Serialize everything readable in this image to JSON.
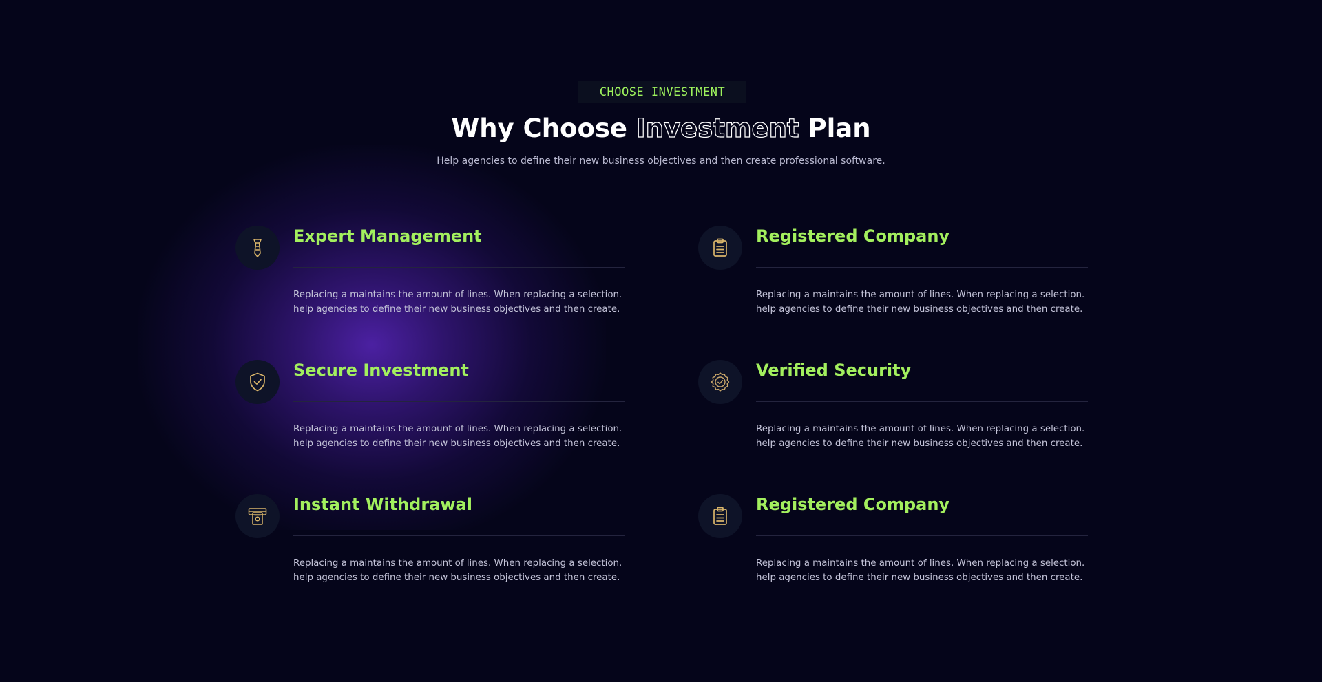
{
  "header": {
    "tag": "CHOOSE INVESTMENT",
    "title_part1": "Why Choose ",
    "title_highlight": "Investment",
    "title_part2": " Plan",
    "subtitle": "Help agencies to define their new business objectives and then create professional software."
  },
  "features": [
    {
      "title": "Expert Management",
      "icon": "tie-icon",
      "desc_line1": "Replacing a maintains the amount of lines. When replacing a selection.",
      "desc_line2": "help agencies to define their new business objectives and then create."
    },
    {
      "title": "Registered Company",
      "icon": "clipboard-icon",
      "desc_line1": "Replacing a maintains the amount of lines. When replacing a selection.",
      "desc_line2": "help agencies to define their new business objectives and then create."
    },
    {
      "title": "Secure Investment",
      "icon": "shield-check-icon",
      "desc_line1": "Replacing a maintains the amount of lines. When replacing a selection.",
      "desc_line2": "help agencies to define their new business objectives and then create."
    },
    {
      "title": "Verified Security",
      "icon": "verified-badge-icon",
      "desc_line1": "Replacing a maintains the amount of lines. When replacing a selection.",
      "desc_line2": "help agencies to define their new business objectives and then create."
    },
    {
      "title": "Instant Withdrawal",
      "icon": "atm-withdrawal-icon",
      "desc_line1": "Replacing a maintains the amount of lines. When replacing a selection.",
      "desc_line2": "help agencies to define their new business objectives and then create."
    },
    {
      "title": "Registered Company",
      "icon": "clipboard-icon",
      "desc_line1": "Replacing a maintains the amount of lines. When replacing a selection.",
      "desc_line2": "help agencies to define their new business objectives and then create."
    }
  ],
  "colors": {
    "background": "#05051a",
    "accent_green": "#a3ef5e",
    "icon_gold": "#d9b56a",
    "glow_purple": "#5f28c8"
  }
}
